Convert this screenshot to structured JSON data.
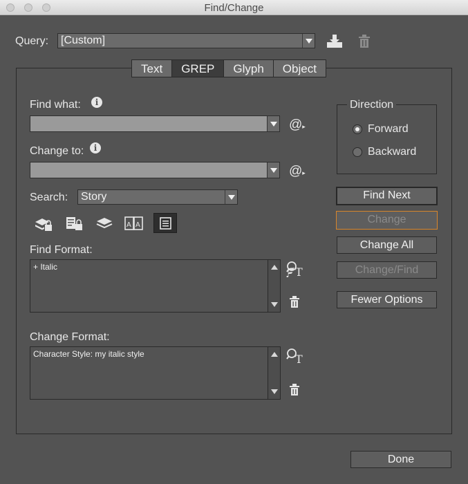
{
  "window": {
    "title": "Find/Change"
  },
  "query": {
    "label": "Query:",
    "value": "[Custom]"
  },
  "tabs": [
    {
      "label": "Text"
    },
    {
      "label": "GREP"
    },
    {
      "label": "Glyph"
    },
    {
      "label": "Object"
    }
  ],
  "find_what": {
    "label": "Find what:",
    "value": ""
  },
  "change_to": {
    "label": "Change to:",
    "value": ""
  },
  "search": {
    "label": "Search:",
    "value": "Story"
  },
  "find_format": {
    "label": "Find Format:",
    "value": "+ Italic"
  },
  "change_format": {
    "label": "Change Format:",
    "value": "Character Style: my italic style"
  },
  "direction": {
    "legend": "Direction",
    "options": [
      {
        "label": "Forward",
        "selected": true
      },
      {
        "label": "Backward",
        "selected": false
      }
    ]
  },
  "buttons": {
    "find_next": "Find Next",
    "change": "Change",
    "change_all": "Change All",
    "change_find": "Change/Find",
    "fewer_options": "Fewer Options",
    "done": "Done"
  },
  "icons": {
    "save_query": "save-query-icon",
    "delete_query": "trash-icon",
    "special_chars": "at-sign-icon",
    "info": "info-icon"
  }
}
